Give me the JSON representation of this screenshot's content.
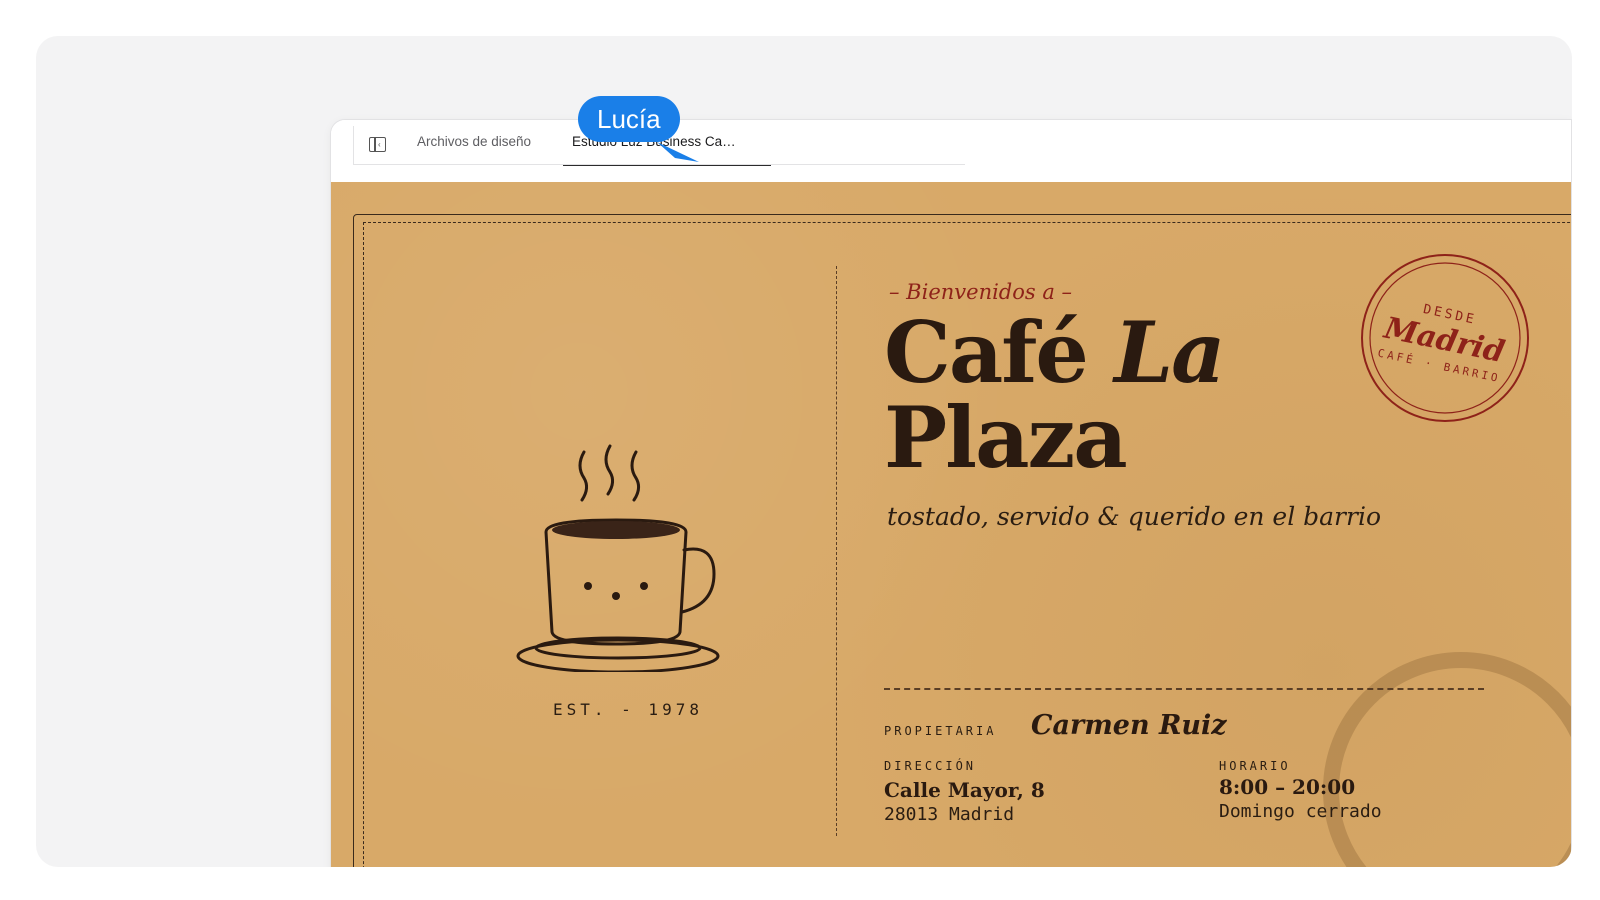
{
  "cursor": {
    "name": "Lucía",
    "color": "#1a7fe8"
  },
  "tabs": [
    {
      "label": "Archivos de diseño"
    },
    {
      "label": "Estudio Luz Business Ca…"
    }
  ],
  "card": {
    "welcome": "– Bienvenidos a –",
    "title_line1_a": "Café ",
    "title_line1_b": "La",
    "title_line2": "Plaza",
    "tagline": "tostado, servido & querido en el barrio",
    "est": "EST. - 1978",
    "stamp": {
      "top": "DESDE",
      "city": "Madrid",
      "bottom": "CAFÉ · BARRIO"
    },
    "owner_label": "PROPIETARIA",
    "owner": "Carmen Ruiz",
    "address_label": "DIRECCIÓN",
    "address_line1": "Calle Mayor, 8",
    "address_line2": "28013 Madrid",
    "hours_label": "HORARIO",
    "hours": "8:00 – 20:00",
    "hours_note": "Domingo cerrado"
  },
  "colors": {
    "kraft": "#d8a968",
    "ink": "#2a1a10",
    "stamp_red": "#8e2219"
  },
  "icons": [
    "sidebar-toggle-icon",
    "coffee-cup-icon",
    "madrid-stamp-icon"
  ]
}
